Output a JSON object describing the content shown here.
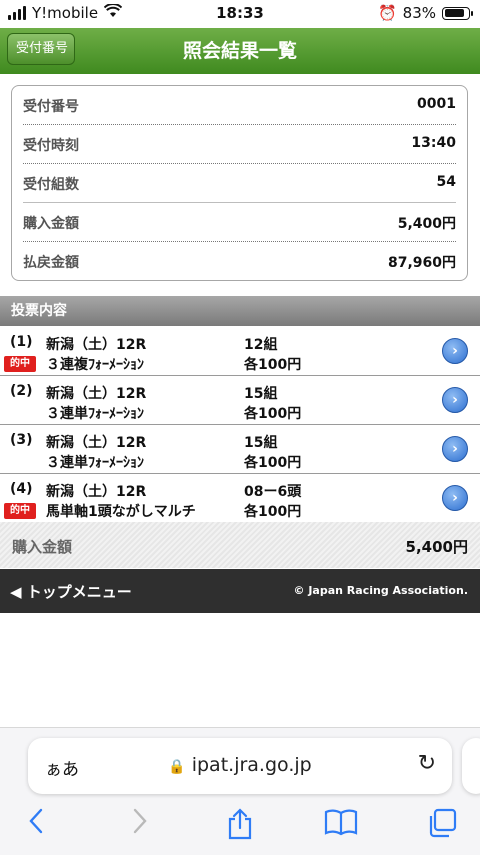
{
  "status_bar": {
    "carrier": "Y!mobile",
    "time": "18:33",
    "battery": "83%"
  },
  "header": {
    "back_label": "受付番号",
    "title": "照会結果一覧"
  },
  "summary": [
    {
      "label": "受付番号",
      "value": "0001"
    },
    {
      "label": "受付時刻",
      "value": "13:40"
    },
    {
      "label": "受付組数",
      "value": "54"
    },
    {
      "label": "購入金額",
      "value": "5,400円"
    },
    {
      "label": "払戻金額",
      "value": "87,960円"
    }
  ],
  "votes_section": {
    "title": "投票内容"
  },
  "votes": [
    {
      "no": "(1)",
      "race": "新潟（土）12R",
      "type": "３連複ﾌｫｰﾒｰｼｮﾝ",
      "count": "12組",
      "amount": "各100円",
      "hit": "的中"
    },
    {
      "no": "(2)",
      "race": "新潟（土）12R",
      "type": "３連単ﾌｫｰﾒｰｼｮﾝ",
      "count": "15組",
      "amount": "各100円",
      "hit": ""
    },
    {
      "no": "(3)",
      "race": "新潟（土）12R",
      "type": "３連単ﾌｫｰﾒｰｼｮﾝ",
      "count": "15組",
      "amount": "各100円",
      "hit": ""
    },
    {
      "no": "(4)",
      "race": "新潟（土）12R",
      "type": "馬単軸1頭ながしマルチ",
      "count": "08ー6頭",
      "amount": "各100円",
      "hit": "的中"
    }
  ],
  "total": {
    "label": "購入金額",
    "value": "5,400円"
  },
  "footer": {
    "menu_label": "◀ トップメニュー",
    "copyright": "© Japan Racing Association."
  },
  "browser": {
    "aa_label": "ぁあ",
    "host": "ipat.jra.go.jp"
  },
  "colors": {
    "header_green": "#4f9a2c",
    "hit_red": "#e0201e",
    "link_blue": "#2f7cf6"
  }
}
